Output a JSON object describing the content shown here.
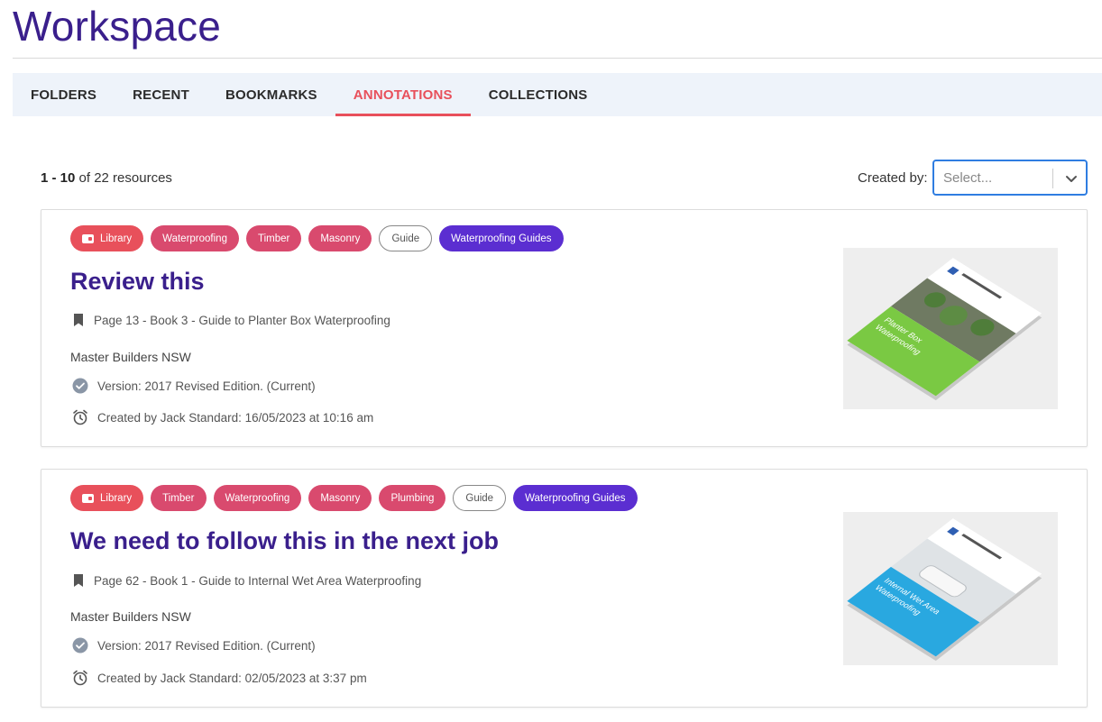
{
  "page": {
    "title": "Workspace"
  },
  "tabs": [
    {
      "label": "FOLDERS",
      "active": false
    },
    {
      "label": "RECENT",
      "active": false
    },
    {
      "label": "BOOKMARKS",
      "active": false
    },
    {
      "label": "ANNOTATIONS",
      "active": true
    },
    {
      "label": "COLLECTIONS",
      "active": false
    }
  ],
  "results": {
    "range": "1 - 10",
    "suffix": " of 22 resources"
  },
  "filter": {
    "label": "Created by:",
    "placeholder": "Select..."
  },
  "cards": [
    {
      "tags": [
        {
          "label": "Library",
          "kind": "library"
        },
        {
          "label": "Waterproofing",
          "kind": "topic"
        },
        {
          "label": "Timber",
          "kind": "topic"
        },
        {
          "label": "Masonry",
          "kind": "topic"
        },
        {
          "label": "Guide",
          "kind": "guide"
        },
        {
          "label": "Waterproofing Guides",
          "kind": "collection"
        }
      ],
      "title": "Review this",
      "bookmark": "Page 13 - Book 3 - Guide to Planter Box Waterproofing",
      "publisher": "Master Builders NSW",
      "version": "Version:  2017 Revised Edition.  (Current)",
      "created": "Created by Jack Standard: 16/05/2023 at 10:16 am",
      "cover": {
        "lines": [
          "Planter Box",
          "Waterproofing"
        ],
        "band_color": "#7ac943"
      }
    },
    {
      "tags": [
        {
          "label": "Library",
          "kind": "library"
        },
        {
          "label": "Timber",
          "kind": "topic"
        },
        {
          "label": "Waterproofing",
          "kind": "topic"
        },
        {
          "label": "Masonry",
          "kind": "topic"
        },
        {
          "label": "Plumbing",
          "kind": "topic"
        },
        {
          "label": "Guide",
          "kind": "guide"
        },
        {
          "label": "Waterproofing Guides",
          "kind": "collection"
        }
      ],
      "title": "We need to follow this in the next job",
      "bookmark": "Page 62 - Book 1 - Guide to Internal Wet Area Waterproofing",
      "publisher": "Master Builders NSW",
      "version": "Version:  2017 Revised Edition.  (Current)",
      "created": "Created by Jack Standard: 02/05/2023 at 3:37 pm",
      "cover": {
        "lines": [
          "Internal Wet Area",
          "Waterproofing"
        ],
        "band_color": "#29a8e0"
      }
    }
  ]
}
